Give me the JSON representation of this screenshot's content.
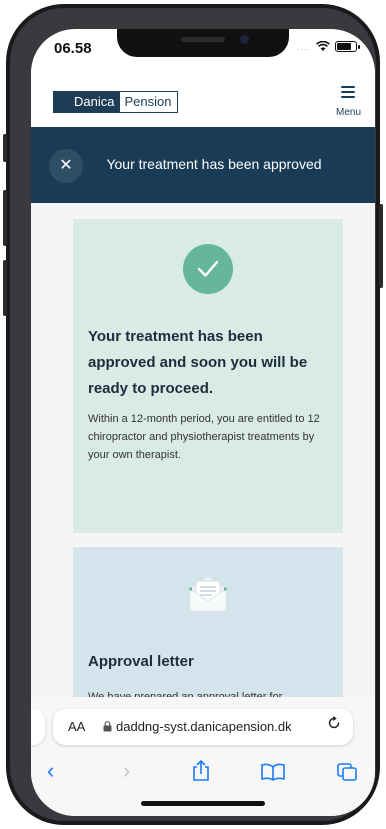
{
  "status": {
    "time": "06.58",
    "signal_dots": "....",
    "wifi_icon": "wifi-icon",
    "battery_icon": "battery-icon"
  },
  "header": {
    "logo_left": "Danica",
    "logo_right": "Pension",
    "menu_label": "Menu"
  },
  "banner": {
    "title": "Your treatment has been approved",
    "close_icon": "close-icon"
  },
  "approval_card": {
    "icon": "check-circle-icon",
    "title": "Your treatment has been approved and soon you will be ready to proceed.",
    "text": "Within a 12-month period, you are entitled to 12 chiropractor and physiotherapist treatments by your own therapist."
  },
  "letter_card": {
    "icon": "envelope-letter-icon",
    "title": "Approval letter",
    "text": "We have prepared an approval letter for"
  },
  "browser": {
    "aa_label": "AA",
    "url": "daddng-syst.danicapension.dk",
    "reload_icon": "reload-icon",
    "nav": {
      "back": "‹",
      "forward": "›"
    }
  },
  "colors": {
    "brand": "#1d3c56",
    "banner": "#193b56",
    "green_card": "#d9ebe5",
    "check": "#66b59d",
    "blue_card": "#d4e4ec",
    "link_blue": "#1a7cf5"
  }
}
